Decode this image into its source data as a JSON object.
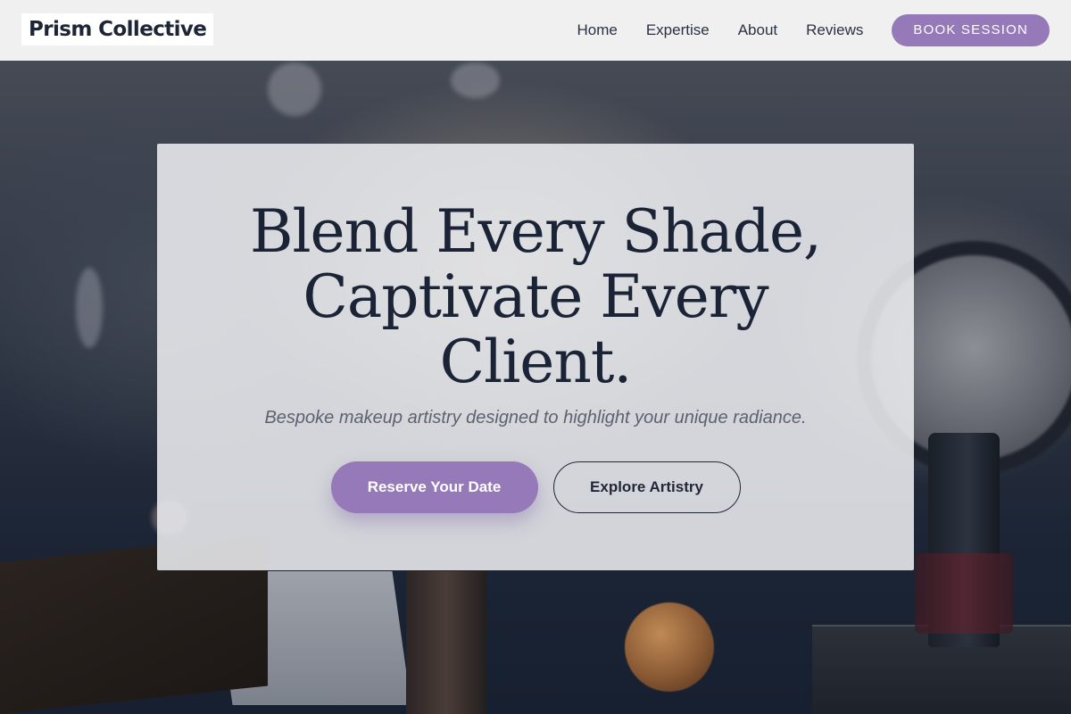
{
  "brand": {
    "name": "Prism Collective"
  },
  "nav": {
    "links": [
      {
        "label": "Home"
      },
      {
        "label": "Expertise"
      },
      {
        "label": "About"
      },
      {
        "label": "Reviews"
      }
    ],
    "cta_label": "BOOK SESSION"
  },
  "hero": {
    "title_lines": [
      "Blend Every Shade,",
      "Captivate Every",
      "Client."
    ],
    "subtitle": "Bespoke makeup artistry designed to highlight your unique radiance.",
    "primary_button": "Reserve Your Date",
    "secondary_button": "Explore Artistry"
  },
  "colors": {
    "accent": "#9679b8",
    "heading": "#1b2336",
    "navbar_bg": "#f6f6f6"
  }
}
